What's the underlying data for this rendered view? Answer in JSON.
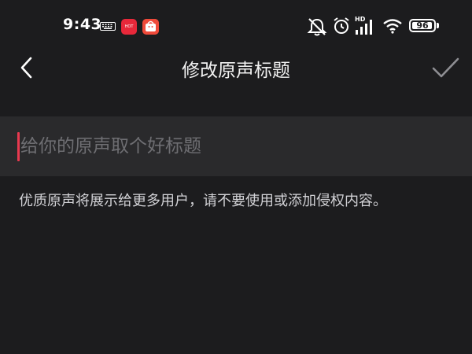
{
  "status_bar": {
    "time": "9:43",
    "app_badge_text": "HOT",
    "signal_label": "HD",
    "battery_level": "96",
    "battery_percent": 96
  },
  "nav": {
    "title": "修改原声标题"
  },
  "form": {
    "title_value": "",
    "title_placeholder": "给你的原声取个好标题",
    "hint": "优质原声将展示给更多用户，请不要使用或添加侵权内容。"
  },
  "colors": {
    "background": "#1c1c1e",
    "input_background": "#2a2a2c",
    "accent_caret": "#e8394f",
    "placeholder": "#6e6e72"
  }
}
